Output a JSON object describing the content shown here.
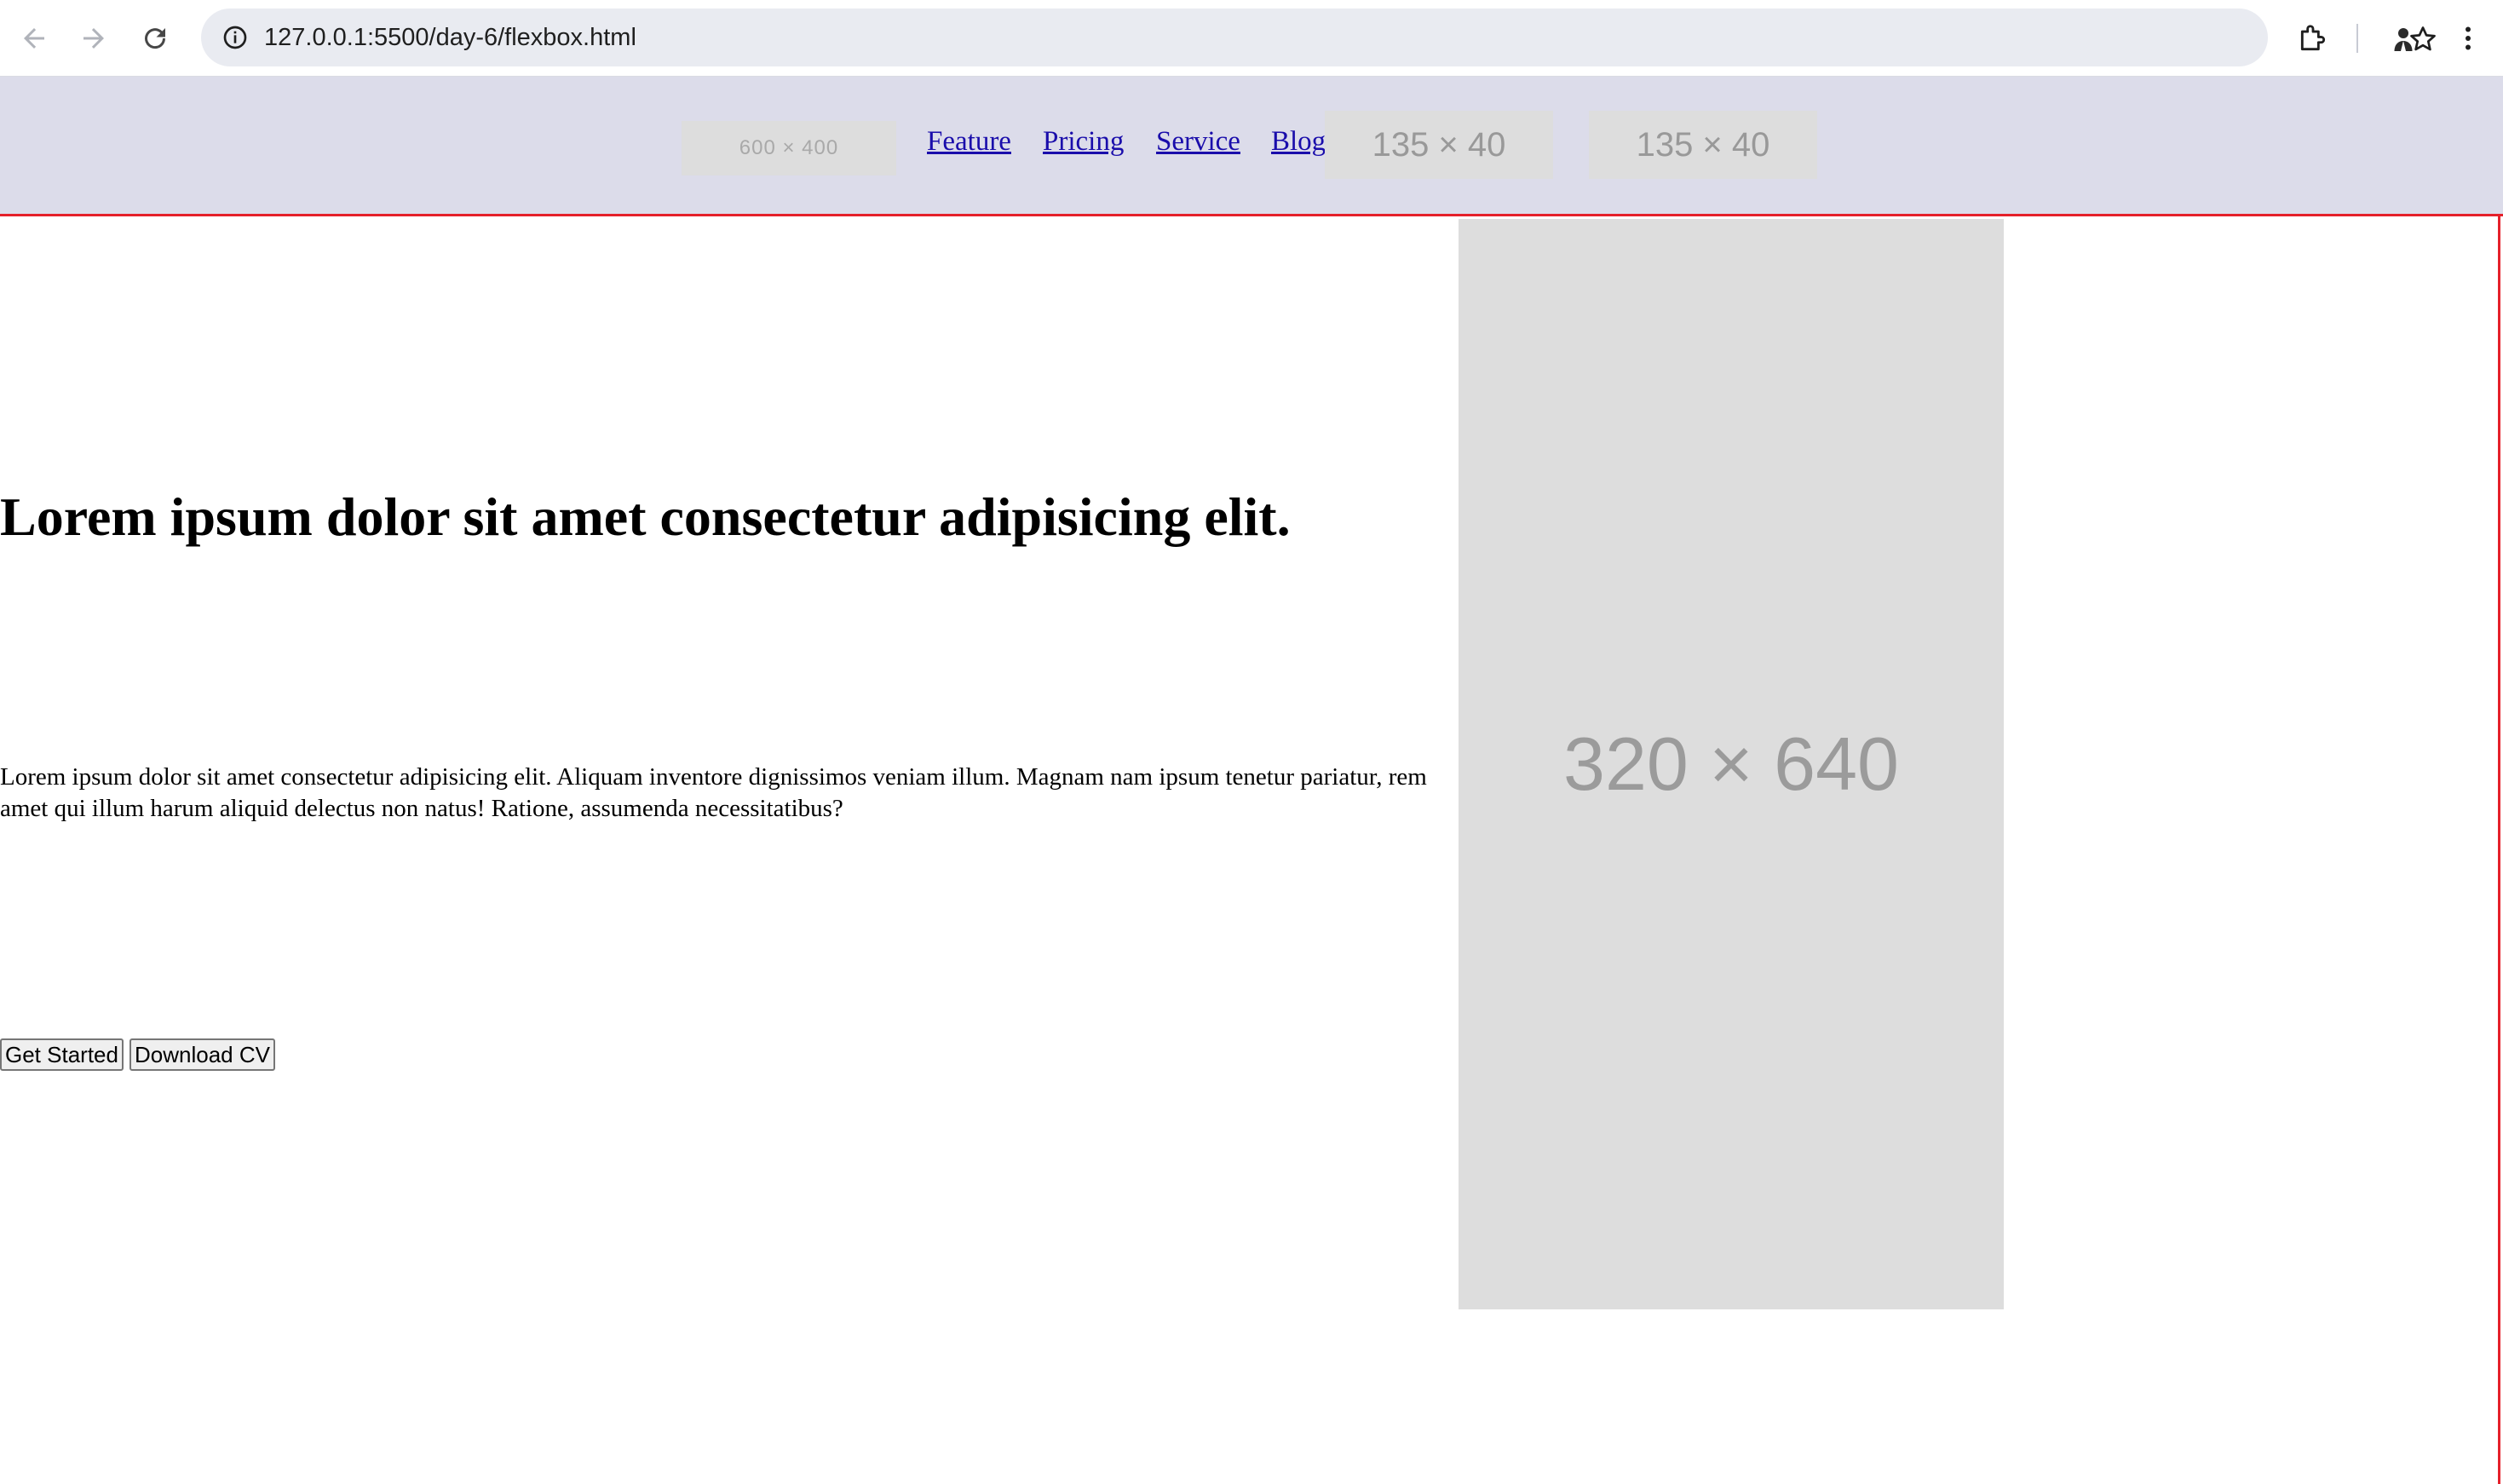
{
  "browser": {
    "url": "127.0.0.1:5500/day-6/flexbox.html",
    "icons": {
      "back": "arrow-left-icon",
      "forward": "arrow-right-icon",
      "reload": "reload-icon",
      "site_info": "info-icon",
      "bookmark": "star-icon",
      "extensions": "puzzle-icon",
      "profile": "avatar-icon",
      "menu": "kebab-menu-icon"
    }
  },
  "header": {
    "logo_placeholder": "600 × 400",
    "nav": [
      {
        "label": "Feature"
      },
      {
        "label": "Pricing"
      },
      {
        "label": "Service"
      },
      {
        "label": "Blog"
      }
    ],
    "button_placeholders": [
      "135 × 40",
      "135 × 40"
    ],
    "background": "#dcdcea",
    "border_color": "#e5202a"
  },
  "hero": {
    "heading": "Lorem ipsum dolor sit amet consectetur adipisicing elit.",
    "paragraph": "Lorem ipsum dolor sit amet consectetur adipisicing elit. Aliquam inventore dignissimos veniam illum. Magnam nam ipsum tenetur pariatur, rem amet qui illum harum aliquid delectus non natus! Ratione, assumenda necessitatibus?",
    "buttons": {
      "primary": "Get Started",
      "secondary": "Download CV"
    },
    "image_placeholder": "320 × 640"
  }
}
